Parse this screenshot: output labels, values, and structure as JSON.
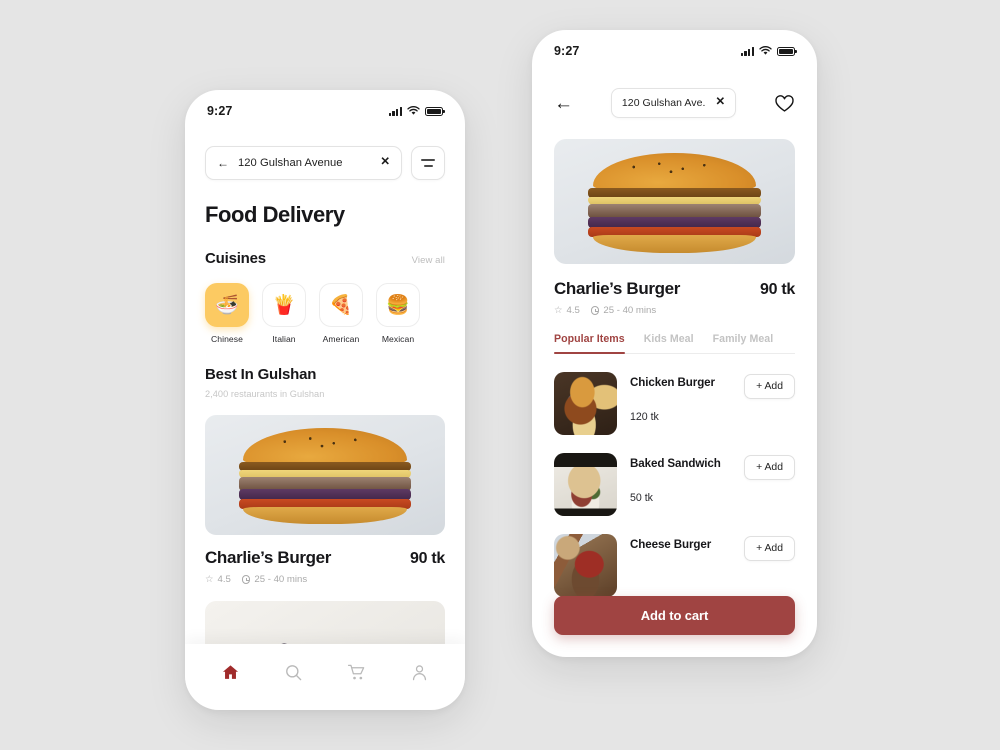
{
  "canvas": {
    "background": "#e5e5e5"
  },
  "theme": {
    "accent": "#a04442",
    "highlight": "#fcca62",
    "text": "#17171a",
    "muted": "#a9a9a9"
  },
  "left_phone": {
    "status": {
      "time": "9:27",
      "signal_icon": "cellular-signal-icon",
      "wifi_icon": "wifi-icon",
      "battery_icon": "battery-full-icon"
    },
    "search": {
      "back_icon": "arrow-left-icon",
      "address": "120 Gulshan Avenue",
      "clear_icon": "close-x-icon",
      "filter_icon": "filter-lines-icon"
    },
    "page_title": "Food Delivery",
    "cuisines_section": {
      "title": "Cuisines",
      "view_all": "View all",
      "items": [
        {
          "label": "Chinese",
          "glyph": "🍜",
          "icon_name": "noodle-bowl-icon",
          "active": true
        },
        {
          "label": "Italian",
          "glyph": "🍟",
          "icon_name": "fries-cup-icon",
          "active": false
        },
        {
          "label": "American",
          "glyph": "🍕",
          "icon_name": "pizza-slice-icon",
          "active": false
        },
        {
          "label": "Mexican",
          "glyph": "🍔",
          "icon_name": "burger-icon",
          "active": false
        }
      ]
    },
    "best_section": {
      "title": "Best In Gulshan",
      "subtitle": "2,400 restaurants in Gulshan"
    },
    "restaurants": [
      {
        "name": "Charlie’s Burger",
        "price": "90 tk",
        "rating": "4.5",
        "star_icon": "star-outline-icon",
        "time_icon": "clock-icon",
        "delivery_time": "25 - 40 mins",
        "image_name": "burger-photo"
      },
      {
        "name": "",
        "price": "",
        "rating": "",
        "delivery_time": "",
        "image_name": "dessert-plate-photo"
      }
    ],
    "bottom_nav": [
      {
        "label": "Home",
        "icon_name": "home-icon",
        "active": true
      },
      {
        "label": "Search",
        "icon_name": "search-icon",
        "active": false
      },
      {
        "label": "Cart",
        "icon_name": "cart-icon",
        "active": false
      },
      {
        "label": "Profile",
        "icon_name": "person-icon",
        "active": false
      }
    ]
  },
  "right_phone": {
    "status": {
      "time": "9:27",
      "signal_icon": "cellular-signal-icon",
      "wifi_icon": "wifi-icon",
      "battery_icon": "battery-full-icon"
    },
    "header": {
      "back_icon": "arrow-left-icon",
      "address": "120 Gulshan Ave.",
      "clear_icon": "close-x-icon",
      "favorite_icon": "heart-outline-icon"
    },
    "hero_image_name": "burger-hero-photo",
    "restaurant": {
      "name": "Charlie’s Burger",
      "price": "90 tk",
      "rating": "4.5",
      "star_icon": "star-outline-icon",
      "time_icon": "clock-icon",
      "delivery_time": "25 - 40 mins"
    },
    "tabs": [
      {
        "label": "Popular Items",
        "active": true
      },
      {
        "label": "Kids Meal",
        "active": false
      },
      {
        "label": "Family Meal",
        "active": false
      }
    ],
    "menu_items": [
      {
        "name": "Chicken Burger",
        "price": "120 tk",
        "add_label": "+ Add",
        "image_name": "chicken-burger-photo"
      },
      {
        "name": "Baked Sandwich",
        "price": "50 tk",
        "add_label": "+ Add",
        "image_name": "baked-sandwich-photo"
      },
      {
        "name": "Cheese Burger",
        "price": "",
        "add_label": "+ Add",
        "image_name": "cheese-burger-photo"
      }
    ],
    "add_to_cart_label": "Add to cart"
  }
}
